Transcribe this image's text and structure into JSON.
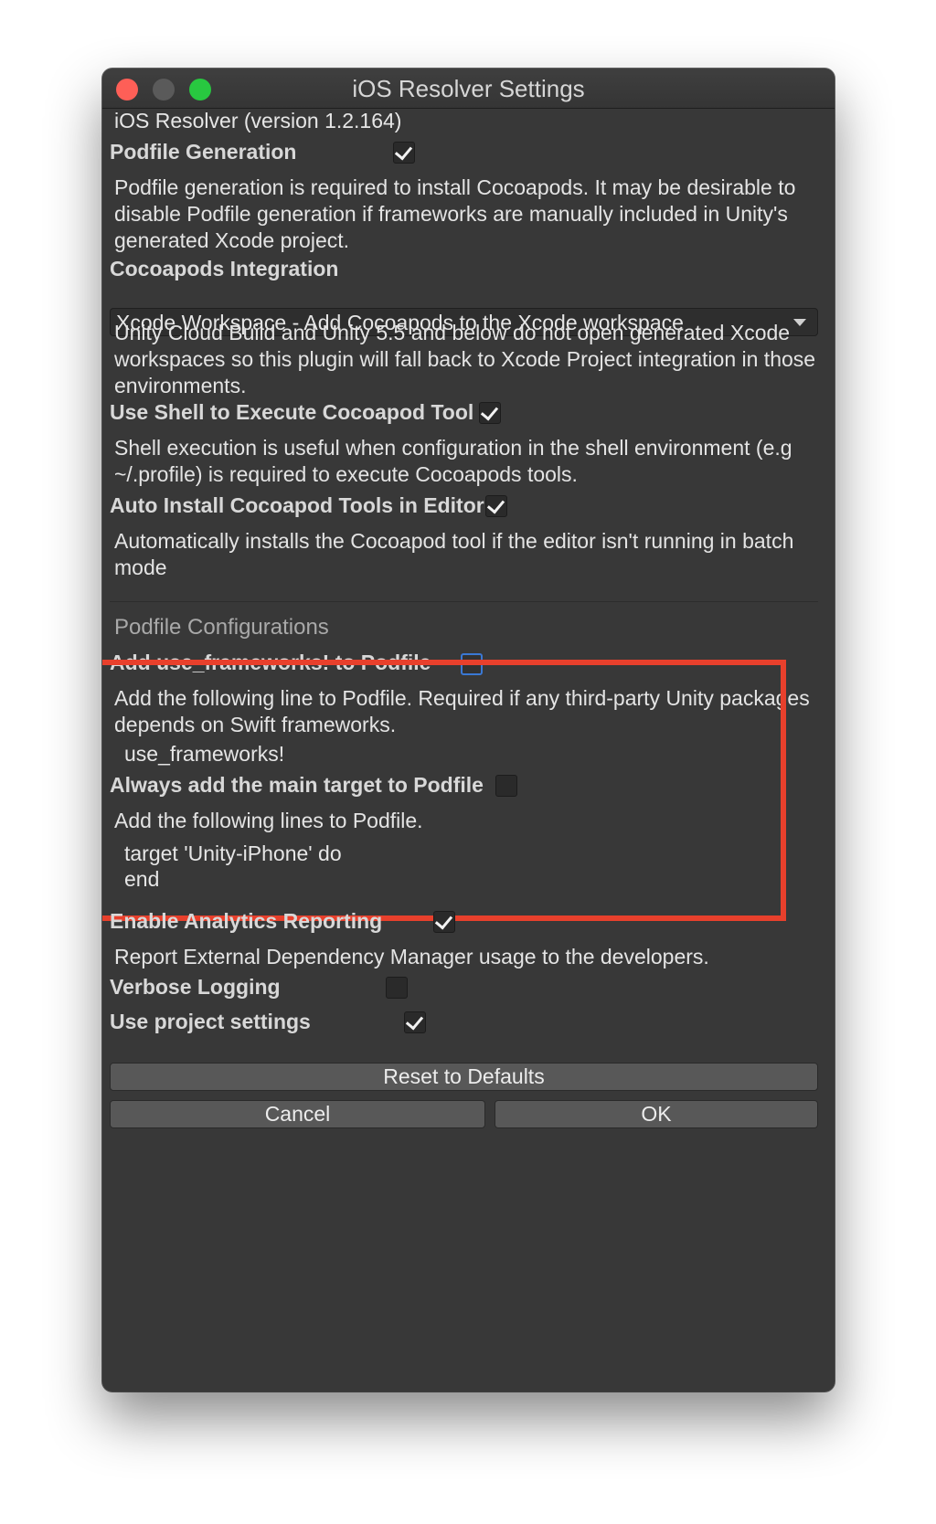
{
  "window": {
    "title": "iOS Resolver Settings"
  },
  "header": {
    "version": "iOS Resolver (version 1.2.164)"
  },
  "podfile_generation": {
    "label": "Podfile Generation",
    "checked": true,
    "description": "Podfile generation is required to install Cocoapods.  It may be desirable to disable Podfile generation if frameworks are manually included in Unity's generated Xcode project."
  },
  "cocoapods_integration": {
    "label": "Cocoapods Integration",
    "selected": "Xcode Workspace - Add Cocoapods to the Xcode workspace",
    "description": "Unity Cloud Build and Unity 5.5 and below do not open generated Xcode workspaces so this plugin will fall back to Xcode Project integration in those environments."
  },
  "use_shell": {
    "label": "Use Shell to Execute Cocoapod Tool",
    "checked": true,
    "description": "Shell execution is useful when configuration in the shell environment (e.g ~/.profile) is required to execute Cocoapods tools."
  },
  "auto_install": {
    "label": "Auto Install Cocoapod Tools in Editor",
    "checked": true,
    "description": "Automatically installs the Cocoapod tool if the editor isn't running in batch mode"
  },
  "podfile_configurations": {
    "title": "Podfile Configurations",
    "use_frameworks": {
      "label": "Add use_frameworks! to Podfile",
      "checked": false,
      "description": "Add the following line to Podfile. Required if any third-party Unity packages depends on Swift frameworks.",
      "code": "use_frameworks!"
    },
    "main_target": {
      "label": "Always add the main target to Podfile",
      "checked": false,
      "description": "Add the following lines to Podfile.",
      "code_line_1": "target 'Unity-iPhone' do",
      "code_line_2": "end"
    }
  },
  "analytics": {
    "label": "Enable Analytics Reporting",
    "checked": true,
    "description": "Report External Dependency Manager usage to the developers."
  },
  "verbose_logging": {
    "label": "Verbose Logging",
    "checked": false
  },
  "project_settings": {
    "label": "Use project settings",
    "checked": true
  },
  "buttons": {
    "reset": "Reset to Defaults",
    "cancel": "Cancel",
    "ok": "OK"
  },
  "colors": {
    "window_bg": "#383838",
    "highlight": "#e8402c",
    "focus_ring": "#3a78d4"
  }
}
